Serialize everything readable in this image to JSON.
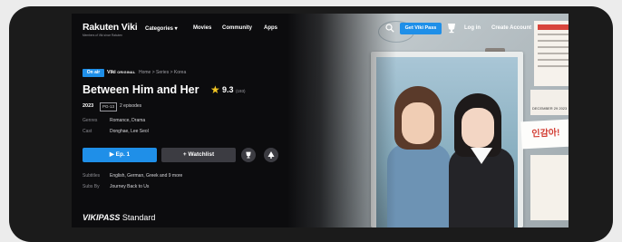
{
  "nav": {
    "logo": "Rakuten Viki",
    "logo_tagline": "Members of Viki since Rakuten",
    "links": [
      "Categories ▾",
      "Movies",
      "Community",
      "Apps"
    ],
    "get_pass": "Get Viki Pass",
    "login": "Log in",
    "create_account": "Create Account"
  },
  "show": {
    "on_air": "On air",
    "viki_original": "Viki",
    "viki_original_suffix": "ORIGINAL",
    "breadcrumb": "Home > Series > Korea",
    "title": "Between Him and Her",
    "rating": "9.3",
    "rating_count": "(193)",
    "year": "2023",
    "age_rating": "PG-13",
    "episodes": "2 episodes",
    "genres_label": "Genres",
    "genres": "Romance, Drama",
    "cast_label": "Cast",
    "cast": "Donghae, Lee Seol",
    "subtitles_label": "Subtitles",
    "subtitles": "English, German, Greek and 9 more",
    "subs_by_label": "Subs By",
    "subs_by": "Journey Back to Us"
  },
  "actions": {
    "play": "▶  Ep. 1",
    "watchlist": "+ Watchlist"
  },
  "footer": {
    "brand": "VIKIPASS",
    "tier": "Standard"
  },
  "artwork": {
    "note_text": "인감아!",
    "receipt_text": "DECEMBER 29 2023"
  },
  "colors": {
    "accent": "#1f8fe8",
    "star": "#f3c623",
    "background": "#0c0c0e"
  }
}
